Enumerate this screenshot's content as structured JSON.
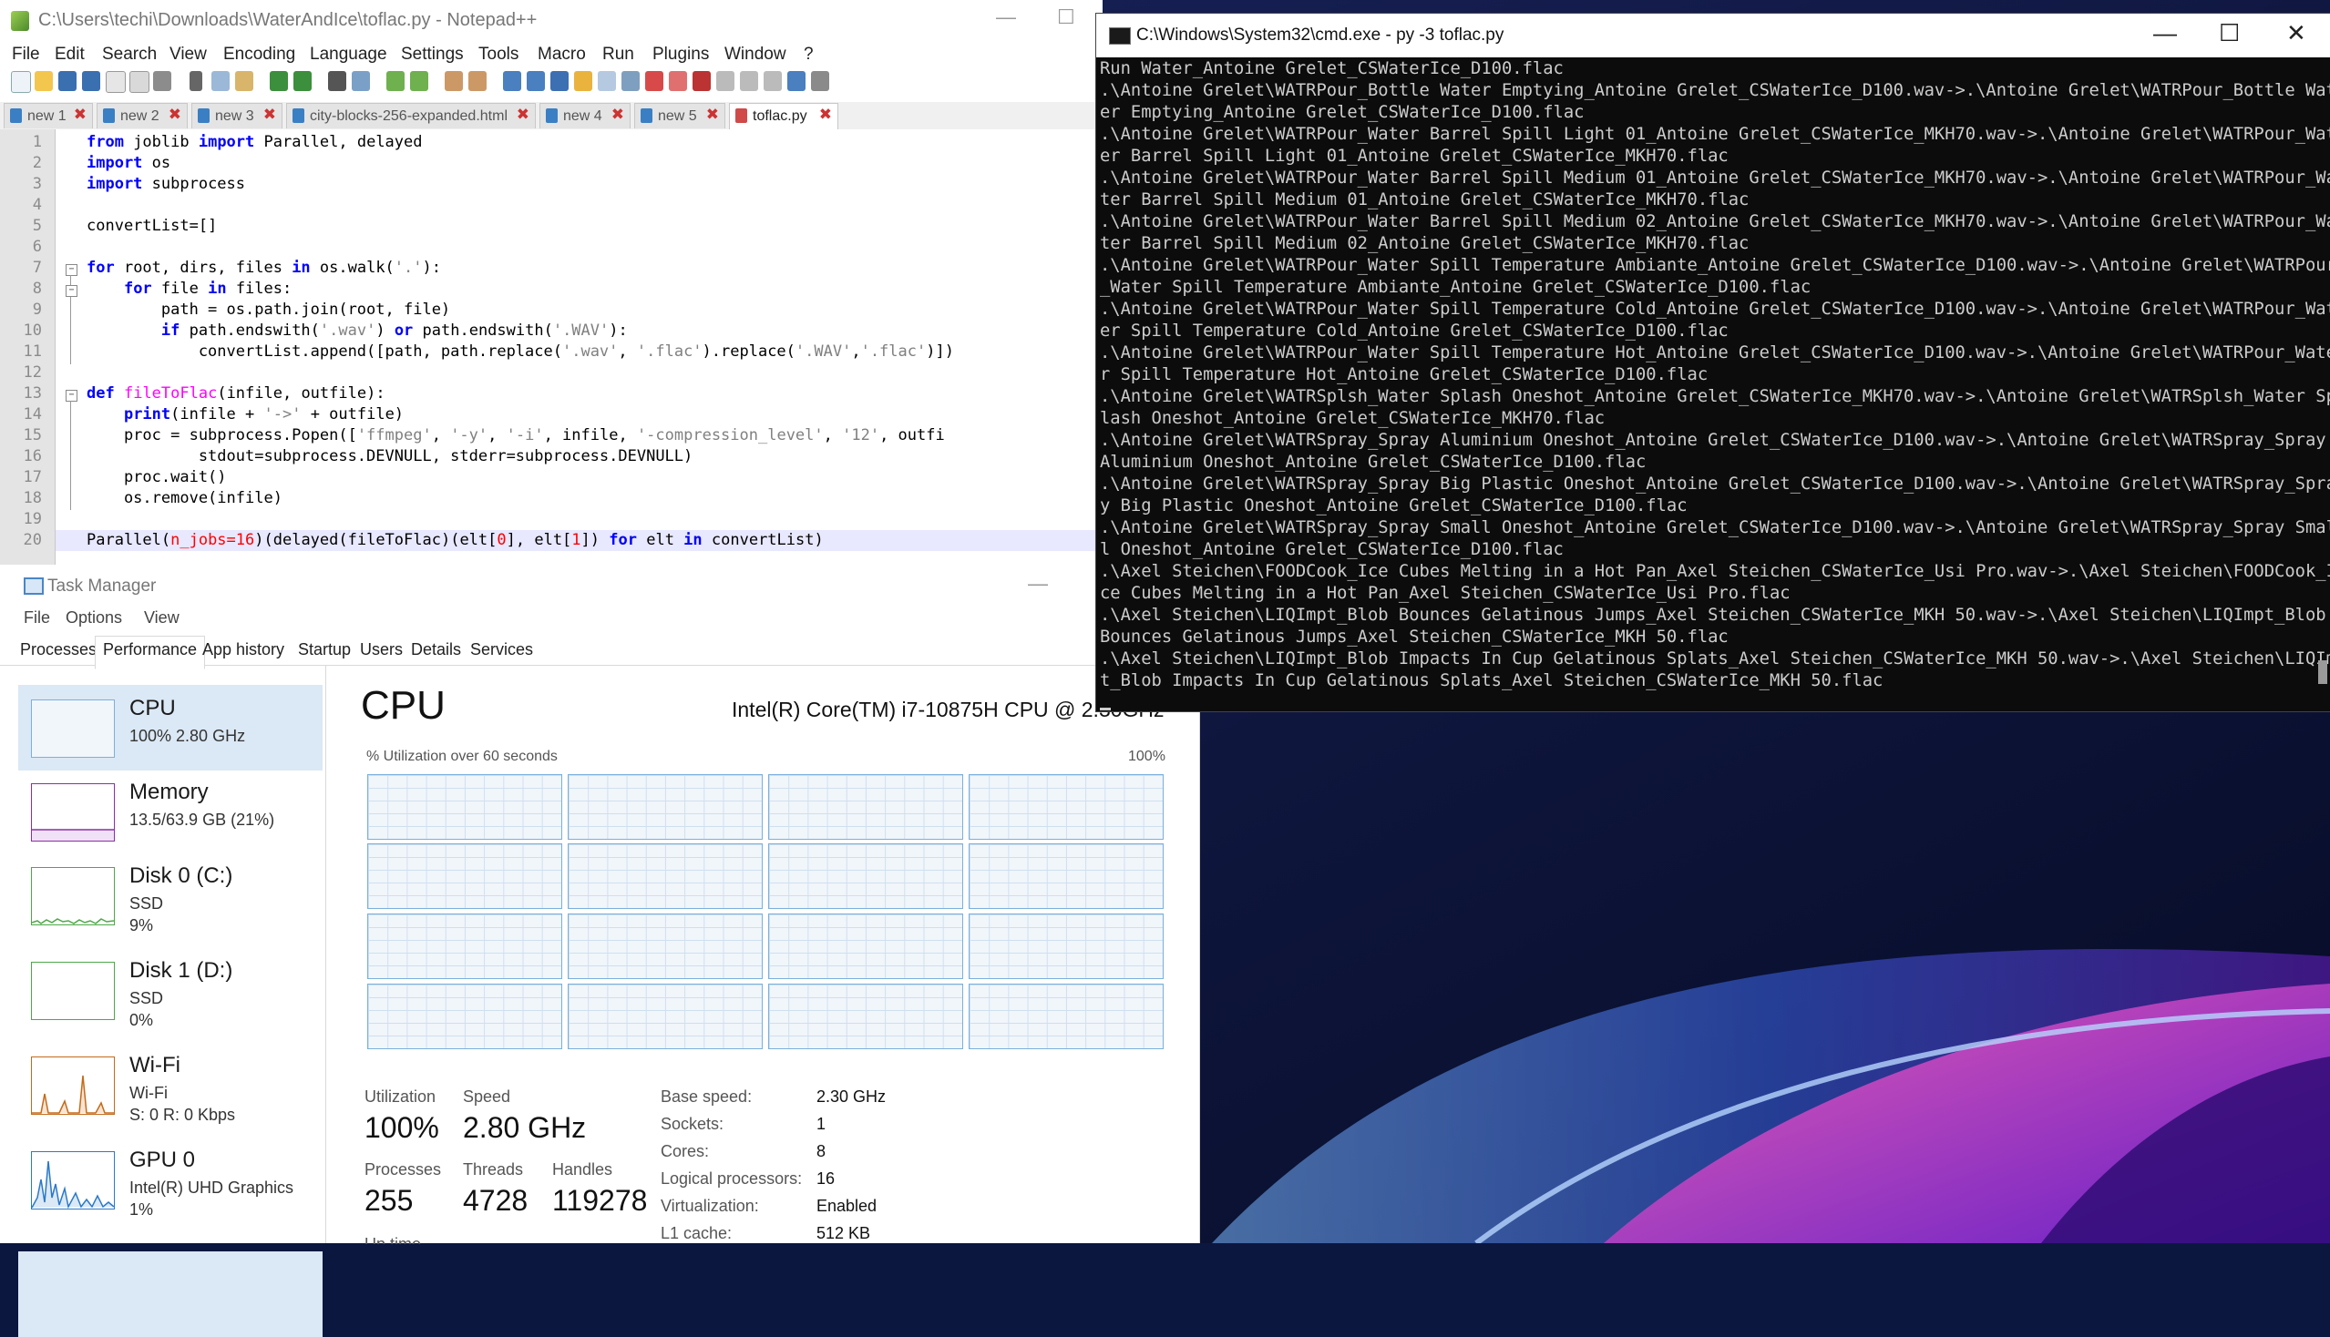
{
  "notepad": {
    "title": "C:\\Users\\techi\\Downloads\\WaterAndIce\\toflac.py - Notepad++",
    "menu": [
      "File",
      "Edit",
      "Search",
      "View",
      "Encoding",
      "Language",
      "Settings",
      "Tools",
      "Macro",
      "Run",
      "Plugins",
      "Window",
      "?"
    ],
    "tabs": [
      "new 1",
      "new 2",
      "new 3",
      "city-blocks-256-expanded.html",
      "new 4",
      "new 5",
      "toflac.py"
    ],
    "active_tab": "toflac.py",
    "line_numbers": [
      "1",
      "2",
      "3",
      "4",
      "5",
      "6",
      "7",
      "8",
      "9",
      "10",
      "11",
      "12",
      "13",
      "14",
      "15",
      "16",
      "17",
      "18",
      "19",
      "20"
    ],
    "code": {
      "l1": [
        "from",
        " joblib ",
        "import",
        " Parallel, delayed"
      ],
      "l2": [
        "import",
        " os"
      ],
      "l3": [
        "import",
        " subprocess"
      ],
      "l5": "convertList=[]",
      "l7": [
        "for",
        " root, dirs, files ",
        "in",
        " os.walk(",
        "'.'",
        "):"
      ],
      "l8": [
        "    ",
        "for",
        " file ",
        "in",
        " files:"
      ],
      "l9": "        path = os.path.join(root, file)",
      "l10": [
        "        ",
        "if",
        " path.endswith(",
        "'.wav'",
        ") ",
        "or",
        " path.endswith(",
        "'.WAV'",
        "):"
      ],
      "l11": [
        "            convertList.append([path, path.replace(",
        "'.wav'",
        ", ",
        "'.flac'",
        ").replace(",
        "'.WAV'",
        ",",
        "'.flac'",
        ")])"
      ],
      "l13": [
        "def",
        " ",
        "fileToFlac",
        "(infile, outfile):"
      ],
      "l14": [
        "    ",
        "print",
        "(infile + ",
        "'->'",
        " + outfile)"
      ],
      "l15": [
        "    proc = subprocess.Popen([",
        "'ffmpeg'",
        ", ",
        "'-y'",
        ", ",
        "'-i'",
        ", infile, ",
        "'-compression_level'",
        ", ",
        "'12'",
        ", outfi"
      ],
      "l16": "            stdout=subprocess.DEVNULL, stderr=subprocess.DEVNULL)",
      "l17": "    proc.wait()",
      "l18": "    os.remove(infile)",
      "l20": [
        "Parallel(",
        "n_jobs=16",
        ")",
        "(delayed(fileToFlac)",
        "(elt[",
        "0",
        "], elt[",
        "1",
        "]) ",
        "for",
        " elt ",
        "in",
        " convertList)"
      ]
    }
  },
  "taskmanager": {
    "title": "Task Manager",
    "menu": [
      "File",
      "Options",
      "View"
    ],
    "tabs": [
      "Processes",
      "Performance",
      "App history",
      "Startup",
      "Users",
      "Details",
      "Services"
    ],
    "active_tab": "Performance",
    "sidebar": [
      {
        "name": "CPU",
        "sub1": "100%  2.80 GHz",
        "sub2": "",
        "sub3": ""
      },
      {
        "name": "Memory",
        "sub1": "13.5/63.9 GB (21%)",
        "sub2": "",
        "sub3": ""
      },
      {
        "name": "Disk 0 (C:)",
        "sub1": "SSD",
        "sub2": "9%",
        "sub3": ""
      },
      {
        "name": "Disk 1 (D:)",
        "sub1": "SSD",
        "sub2": "0%",
        "sub3": ""
      },
      {
        "name": "Wi-Fi",
        "sub1": "Wi-Fi",
        "sub2": "S: 0  R: 0 Kbps",
        "sub3": ""
      },
      {
        "name": "GPU 0",
        "sub1": "Intel(R) UHD Graphics",
        "sub2": "1%",
        "sub3": ""
      }
    ],
    "cpu": {
      "heading": "CPU",
      "model": "Intel(R) Core(TM) i7-10875H CPU @ 2.30GHz",
      "caption": "% Utilization over 60 seconds",
      "max": "100%",
      "utilization_label": "Utilization",
      "utilization": "100%",
      "speed_label": "Speed",
      "speed": "2.80 GHz",
      "processes_label": "Processes",
      "processes": "255",
      "threads_label": "Threads",
      "threads": "4728",
      "handles_label": "Handles",
      "handles": "119278",
      "uptime_label": "Up time",
      "props": [
        {
          "k": "Base speed:",
          "v": "2.30 GHz"
        },
        {
          "k": "Sockets:",
          "v": "1"
        },
        {
          "k": "Cores:",
          "v": "8"
        },
        {
          "k": "Logical processors:",
          "v": "16"
        },
        {
          "k": "Virtualization:",
          "v": "Enabled"
        },
        {
          "k": "L1 cache:",
          "v": "512 KB"
        }
      ]
    }
  },
  "cmd": {
    "title": "C:\\Windows\\System32\\cmd.exe - py  -3 toflac.py",
    "lines": [
      "Run Water_Antoine Grelet_CSWaterIce_D100.flac",
      ".\\Antoine Grelet\\WATRPour_Bottle Water Emptying_Antoine Grelet_CSWaterIce_D100.wav->.\\Antoine Grelet\\WATRPour_Bottle Wat",
      "er Emptying_Antoine Grelet_CSWaterIce_D100.flac",
      ".\\Antoine Grelet\\WATRPour_Water Barrel Spill Light 01_Antoine Grelet_CSWaterIce_MKH70.wav->.\\Antoine Grelet\\WATRPour_Wat",
      "er Barrel Spill Light 01_Antoine Grelet_CSWaterIce_MKH70.flac",
      ".\\Antoine Grelet\\WATRPour_Water Barrel Spill Medium 01_Antoine Grelet_CSWaterIce_MKH70.wav->.\\Antoine Grelet\\WATRPour_Wa",
      "ter Barrel Spill Medium 01_Antoine Grelet_CSWaterIce_MKH70.flac",
      ".\\Antoine Grelet\\WATRPour_Water Barrel Spill Medium 02_Antoine Grelet_CSWaterIce_MKH70.wav->.\\Antoine Grelet\\WATRPour_Wa",
      "ter Barrel Spill Medium 02_Antoine Grelet_CSWaterIce_MKH70.flac",
      ".\\Antoine Grelet\\WATRPour_Water Spill Temperature Ambiante_Antoine Grelet_CSWaterIce_D100.wav->.\\Antoine Grelet\\WATRPour",
      "_Water Spill Temperature Ambiante_Antoine Grelet_CSWaterIce_D100.flac",
      ".\\Antoine Grelet\\WATRPour_Water Spill Temperature Cold_Antoine Grelet_CSWaterIce_D100.wav->.\\Antoine Grelet\\WATRPour_Wat",
      "er Spill Temperature Cold_Antoine Grelet_CSWaterIce_D100.flac",
      ".\\Antoine Grelet\\WATRPour_Water Spill Temperature Hot_Antoine Grelet_CSWaterIce_D100.wav->.\\Antoine Grelet\\WATRPour_Wate",
      "r Spill Temperature Hot_Antoine Grelet_CSWaterIce_D100.flac",
      ".\\Antoine Grelet\\WATRSplsh_Water Splash Oneshot_Antoine Grelet_CSWaterIce_MKH70.wav->.\\Antoine Grelet\\WATRSplsh_Water Sp",
      "lash Oneshot_Antoine Grelet_CSWaterIce_MKH70.flac",
      ".\\Antoine Grelet\\WATRSpray_Spray Aluminium Oneshot_Antoine Grelet_CSWaterIce_D100.wav->.\\Antoine Grelet\\WATRSpray_Spray",
      "Aluminium Oneshot_Antoine Grelet_CSWaterIce_D100.flac",
      ".\\Antoine Grelet\\WATRSpray_Spray Big Plastic Oneshot_Antoine Grelet_CSWaterIce_D100.wav->.\\Antoine Grelet\\WATRSpray_Spra",
      "y Big Plastic Oneshot_Antoine Grelet_CSWaterIce_D100.flac",
      ".\\Antoine Grelet\\WATRSpray_Spray Small Oneshot_Antoine Grelet_CSWaterIce_D100.wav->.\\Antoine Grelet\\WATRSpray_Spray Smal",
      "l Oneshot_Antoine Grelet_CSWaterIce_D100.flac",
      ".\\Axel Steichen\\FOODCook_Ice Cubes Melting in a Hot Pan_Axel Steichen_CSWaterIce_Usi Pro.wav->.\\Axel Steichen\\FOODCook_I",
      "ce Cubes Melting in a Hot Pan_Axel Steichen_CSWaterIce_Usi Pro.flac",
      ".\\Axel Steichen\\LIQImpt_Blob Bounces Gelatinous Jumps_Axel Steichen_CSWaterIce_MKH 50.wav->.\\Axel Steichen\\LIQImpt_Blob",
      "Bounces Gelatinous Jumps_Axel Steichen_CSWaterIce_MKH 50.flac",
      ".\\Axel Steichen\\LIQImpt_Blob Impacts In Cup Gelatinous Splats_Axel Steichen_CSWaterIce_MKH 50.wav->.\\Axel Steichen\\LIQImp",
      "t_Blob Impacts In Cup Gelatinous Splats_Axel Steichen_CSWaterIce_MKH 50.flac"
    ]
  },
  "colors": {
    "cmd_bg": "#0c0c0c",
    "cmd_text": "#cccccc",
    "graph_border": "#7ab0dd",
    "cpu_selected": "#dbe8f5",
    "memory_accent": "#8b2da8",
    "disk_accent": "#4da847",
    "wifi_accent": "#c46a1a",
    "gpu_accent": "#2a79c9"
  }
}
